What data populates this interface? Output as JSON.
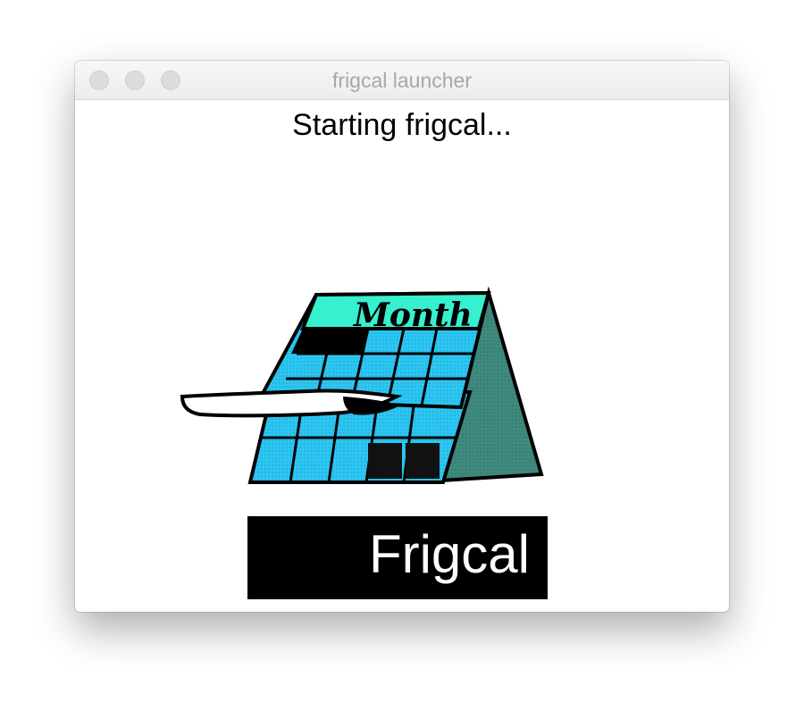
{
  "window": {
    "title": "frigcal launcher"
  },
  "status_text": "Starting frigcal...",
  "illustration": {
    "header_text": "Month",
    "colors": {
      "header": "#37f0cf",
      "cells": "#2cc6f2",
      "back_panel": "#3f8a7e",
      "outline": "#000000"
    }
  },
  "logo": {
    "text": "Frigcal",
    "background": "#000000",
    "color": "#ffffff"
  }
}
